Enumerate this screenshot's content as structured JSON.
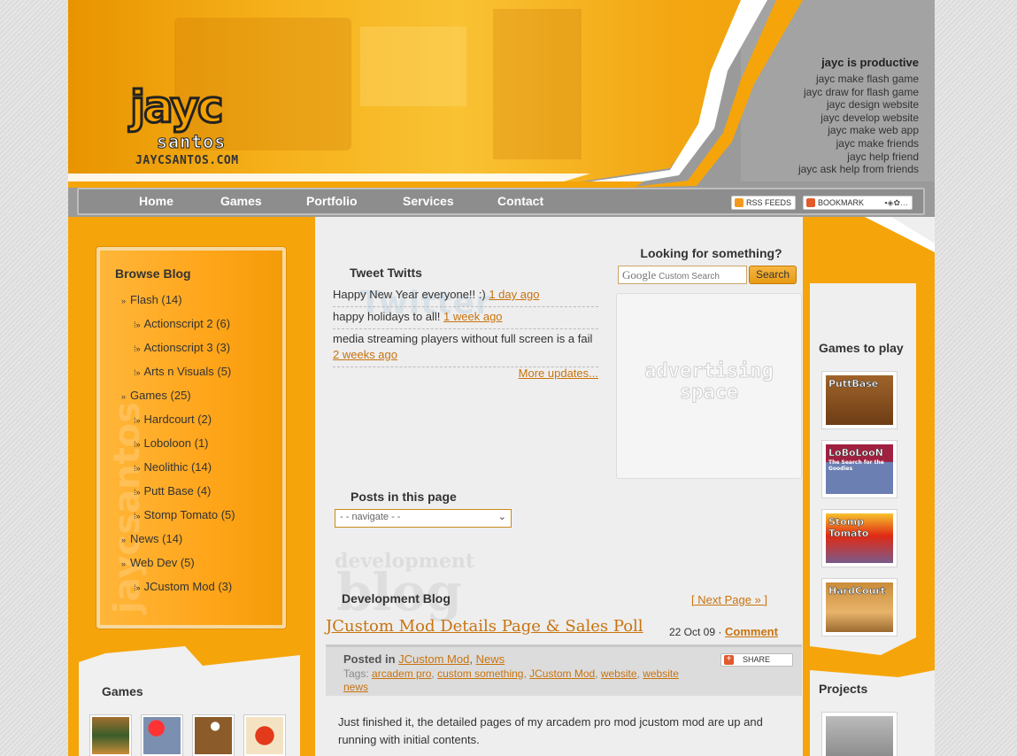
{
  "header": {
    "logo_main": "jayc",
    "logo_sub": "santos",
    "logo_url": "JAYCSANTOS.COM",
    "productive_title": "jayc is productive",
    "productive_items": [
      "jayc make flash game",
      "jayc draw for flash game",
      "jayc design website",
      "jayc develop website",
      "jayc make web app",
      "jayc make friends",
      "jayc help friend",
      "jayc ask help from friends"
    ]
  },
  "nav": {
    "items": [
      "Home",
      "Games",
      "Portfolio",
      "Services",
      "Contact"
    ],
    "rss_label": "RSS FEEDS",
    "bookmark_label": "BOOKMARK"
  },
  "sidebar": {
    "title": "Browse Blog",
    "categories": [
      {
        "label": "Flash (14)",
        "level": 0
      },
      {
        "label": "Actionscript 2 (6)",
        "level": 1
      },
      {
        "label": "Actionscript 3 (3)",
        "level": 1
      },
      {
        "label": "Arts n Visuals (5)",
        "level": 1
      },
      {
        "label": "Games (25)",
        "level": 0
      },
      {
        "label": "Hardcourt (2)",
        "level": 1
      },
      {
        "label": "Loboloon (1)",
        "level": 1
      },
      {
        "label": "Neolithic (14)",
        "level": 1
      },
      {
        "label": "Putt Base (4)",
        "level": 1
      },
      {
        "label": "Stomp Tomato (5)",
        "level": 1
      },
      {
        "label": "News (14)",
        "level": 0
      },
      {
        "label": "Web Dev (5)",
        "level": 0
      },
      {
        "label": "JCustom Mod (3)",
        "level": 1
      }
    ],
    "games_title": "Games"
  },
  "tweets": {
    "title": "Tweet Twitts",
    "watermark": "Twitter",
    "items": [
      {
        "text": "Happy New Year everyone!! :)",
        "ago": "1 day ago"
      },
      {
        "text": "happy holidays to all!",
        "ago": "1 week ago"
      },
      {
        "text": "media streaming players without full screen is a fail",
        "ago": "2 weeks ago"
      }
    ],
    "more": "More updates..."
  },
  "search": {
    "title": "Looking for something?",
    "google": "Google",
    "placeholder": "Custom Search",
    "button": "Search",
    "ad_text_1": "advertising",
    "ad_text_2": "space"
  },
  "posts": {
    "title": "Posts in this page",
    "select_value": "- - navigate - -"
  },
  "blog": {
    "watermark_top": "development",
    "watermark_bottom": "blog",
    "title": "Development Blog",
    "next_page": "[ Next Page » ]",
    "post": {
      "title": "JCustom Mod Details Page & Sales Poll",
      "date": "22 Oct 09",
      "comment": "Comment",
      "posted_in_label": "Posted in",
      "posted_in": [
        "JCustom Mod",
        "News"
      ],
      "tags_label": "Tags:",
      "tags": [
        "arcadem pro",
        "custom something",
        "JCustom Mod",
        "website",
        "website news"
      ],
      "share": "SHARE",
      "body": "Just finished it, the detailed pages of my arcadem pro mod jcustom mod are up and running with initial contents."
    }
  },
  "right": {
    "games_title": "Games to play",
    "games": [
      "PuttBase",
      "LoBoLooN",
      "Stomp Tomato",
      "HardCourt"
    ],
    "games_subtitles": [
      "",
      "The Search for the Goodies",
      "",
      ""
    ],
    "projects_title": "Projects"
  },
  "colors": {
    "accent": "#f5a50a",
    "link": "#c8730e",
    "nav_bg": "#8d8d8d"
  }
}
